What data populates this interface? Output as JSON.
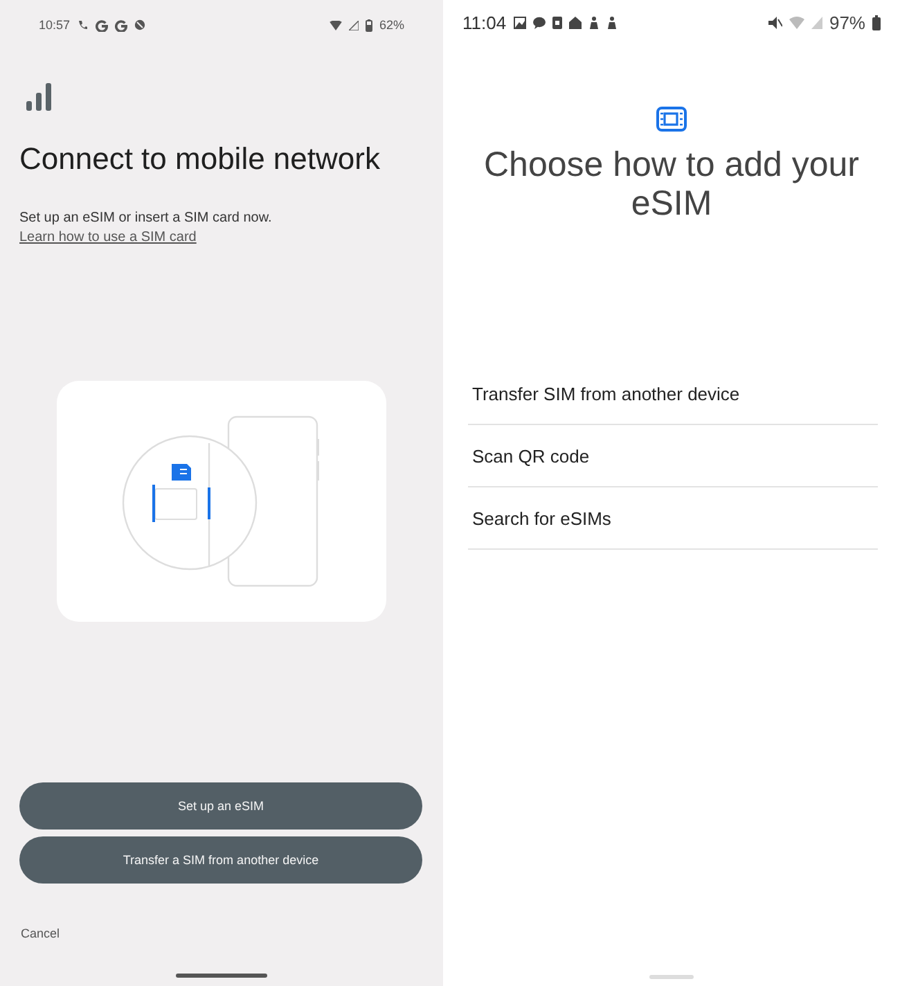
{
  "left_screen": {
    "status_bar": {
      "time": "10:57",
      "battery": "62%"
    },
    "title": "Connect to mobile network",
    "description": {
      "text": "Set up an eSIM or insert a SIM card now.",
      "link": "Learn how to use a SIM card"
    },
    "buttons": [
      "Set up an eSIM",
      "Transfer a SIM from another device"
    ],
    "cancel": "Cancel"
  },
  "right_screen": {
    "status_bar": {
      "time": "11:04",
      "battery": "97%"
    },
    "title": "Choose how to add your eSIM",
    "options": [
      "Transfer SIM from another device",
      "Scan QR code",
      "Search for eSIMs"
    ]
  }
}
